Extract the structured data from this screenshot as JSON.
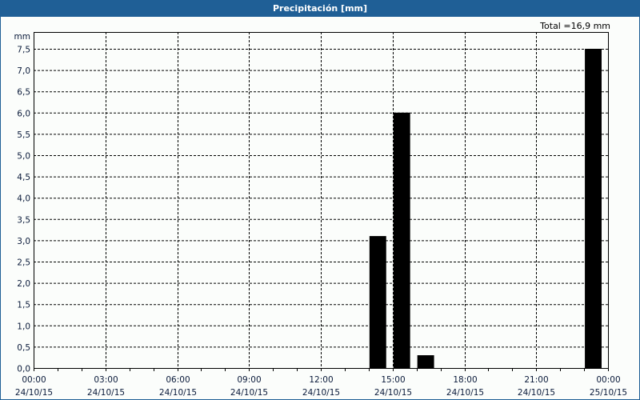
{
  "header": {
    "title": "Precipitación [mm]"
  },
  "total_label": "Total =16,9 mm",
  "chart_data": {
    "type": "bar",
    "title": "Precipitación [mm]",
    "ylabel": "mm",
    "xlabel": "",
    "ylim": [
      0,
      7.5
    ],
    "xlim_hours": [
      0,
      24
    ],
    "y_ticks": [
      "0,0",
      "0,5",
      "1,0",
      "1,5",
      "2,0",
      "2,5",
      "3,0",
      "3,5",
      "4,0",
      "4,5",
      "5,0",
      "5,5",
      "6,0",
      "6,5",
      "7,0",
      "7,5"
    ],
    "x_ticks": [
      {
        "hour": 0,
        "time": "00:00",
        "date": "24/10/15"
      },
      {
        "hour": 3,
        "time": "03:00",
        "date": "24/10/15"
      },
      {
        "hour": 6,
        "time": "06:00",
        "date": "24/10/15"
      },
      {
        "hour": 9,
        "time": "09:00",
        "date": "24/10/15"
      },
      {
        "hour": 12,
        "time": "12:00",
        "date": "24/10/15"
      },
      {
        "hour": 15,
        "time": "15:00",
        "date": "24/10/15"
      },
      {
        "hour": 18,
        "time": "18:00",
        "date": "24/10/15"
      },
      {
        "hour": 21,
        "time": "21:00",
        "date": "24/10/15"
      },
      {
        "hour": 24,
        "time": "00:00",
        "date": "25/10/15"
      }
    ],
    "bars": [
      {
        "start_hour": 14,
        "value": 3.1
      },
      {
        "start_hour": 15,
        "value": 6.0
      },
      {
        "start_hour": 16,
        "value": 0.3
      },
      {
        "start_hour": 23,
        "value": 7.5
      }
    ],
    "bar_color": "#000000",
    "grid": true,
    "total": 16.9
  }
}
